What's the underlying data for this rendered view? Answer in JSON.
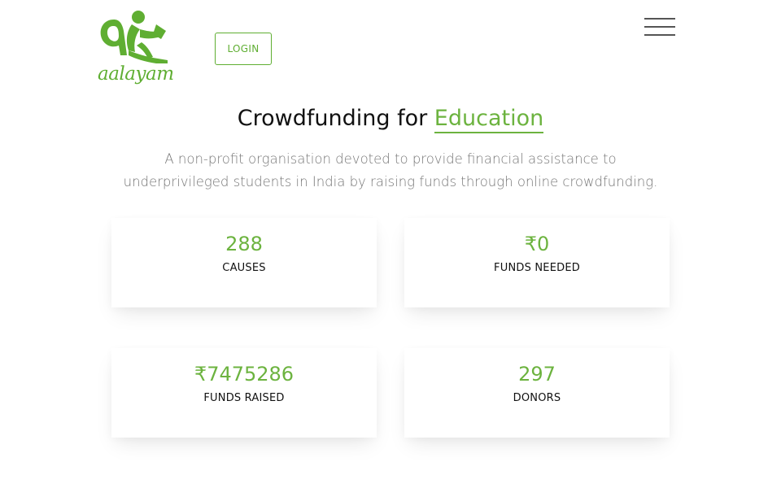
{
  "header": {
    "logo_text": "aalayam",
    "login_label": "LOGIN",
    "menu_icon": "hamburger-icon"
  },
  "hero": {
    "title_prefix": "Crowdfunding for ",
    "title_accent": "Education",
    "description": "A non-profit organisation devoted to provide financial assistance to underprivileged students in India by raising funds through online crowdfunding."
  },
  "stats": {
    "causes": {
      "value": "288",
      "label": "CAUSES"
    },
    "funds_needed": {
      "value": "₹0",
      "label": "FUNDS NEEDED"
    },
    "funds_raised": {
      "value": "₹7475286",
      "label": "FUNDS RAISED"
    },
    "donors": {
      "value": "297",
      "label": "DONORS"
    }
  },
  "colors": {
    "brand_green": "#6cb33f",
    "text_dark": "#111111",
    "text_muted": "#777777"
  }
}
